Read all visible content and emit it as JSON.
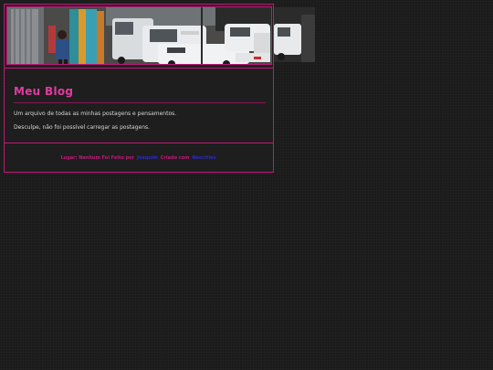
{
  "header": {
    "banner_alt": "street-photo-banner"
  },
  "main": {
    "title": "Meu Blog",
    "description": "Um arquivo de todas as minhas postagens e pensamentos.",
    "error": "Desculpe, não foi possível carregar as postagens."
  },
  "footer": {
    "location_prefix": "Lugar: Nenhum Foi Feito por",
    "author_link": "Joaquim",
    "created_with": "Criado com",
    "tool_link": "Neocities"
  },
  "colors": {
    "accent": "#c0187a",
    "title": "#e23aa0",
    "link": "#2a2acc",
    "background": "#1b1b1b"
  }
}
